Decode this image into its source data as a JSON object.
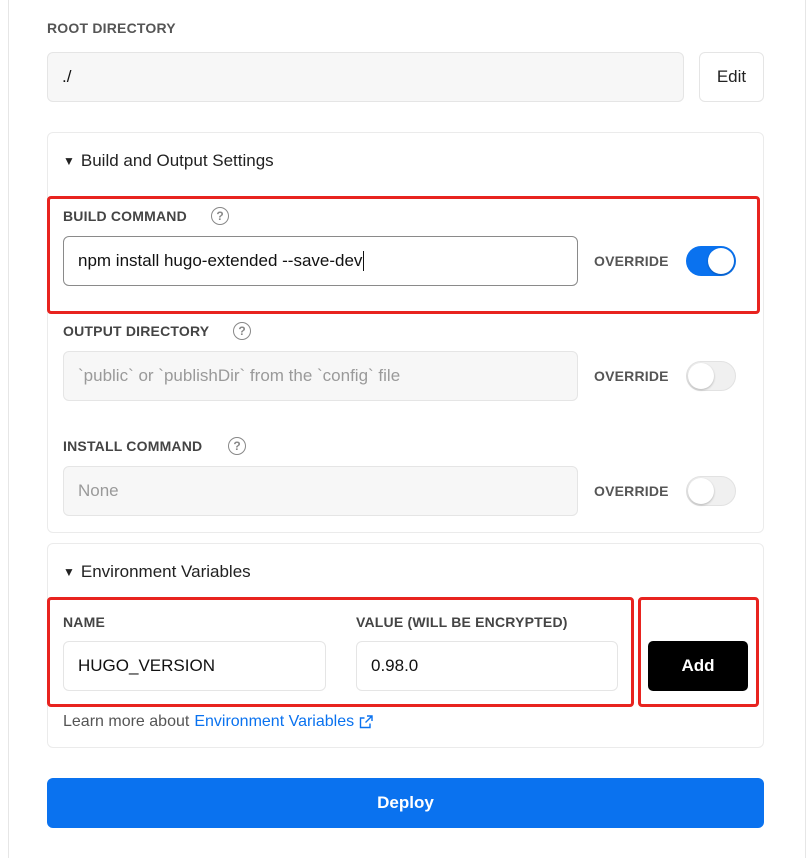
{
  "root_directory": {
    "label": "ROOT DIRECTORY",
    "value": "./",
    "edit_label": "Edit"
  },
  "build_output": {
    "title": "Build and Output Settings",
    "build_command": {
      "label": "BUILD COMMAND",
      "value": "npm install hugo-extended --save-dev",
      "override_label": "OVERRIDE",
      "override_on": true
    },
    "output_directory": {
      "label": "OUTPUT DIRECTORY",
      "placeholder": "`public` or `publishDir` from the `config` file",
      "override_label": "OVERRIDE",
      "override_on": false
    },
    "install_command": {
      "label": "INSTALL COMMAND",
      "placeholder": "None",
      "override_label": "OVERRIDE",
      "override_on": false
    }
  },
  "env_vars": {
    "title": "Environment Variables",
    "name_label": "NAME",
    "name_value": "HUGO_VERSION",
    "value_label": "VALUE (WILL BE ENCRYPTED)",
    "value_value": "0.98.0",
    "add_label": "Add",
    "learn_prefix": "Learn more about",
    "learn_link": "Environment Variables"
  },
  "deploy_label": "Deploy",
  "colors": {
    "accent": "#0a72ef",
    "highlight": "#e8231f"
  },
  "icons": [
    "help-icon",
    "external-link-icon",
    "triangle-down-icon"
  ]
}
